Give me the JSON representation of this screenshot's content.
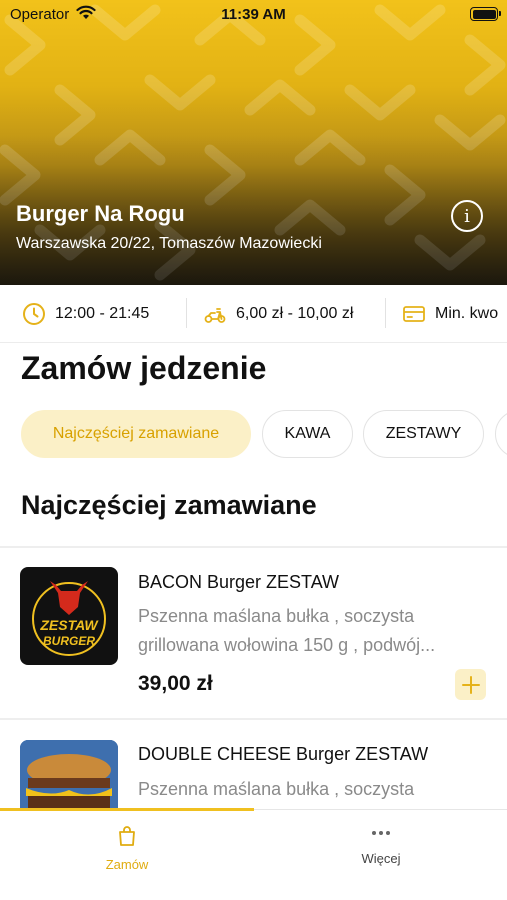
{
  "status_bar": {
    "carrier": "Operator",
    "time": "11:39 AM"
  },
  "restaurant": {
    "name": "Burger Na Rogu",
    "address": "Warszawska 20/22, Tomaszów Mazowiecki"
  },
  "info_strip": {
    "hours": "12:00 - 21:45",
    "delivery_fee": "6,00 zł - 10,00 zł",
    "min_order": "Min. kwo",
    "icons": [
      "clock-icon",
      "scooter-icon",
      "card-icon"
    ]
  },
  "section_heading": "Zamów jedzenie",
  "categories": [
    {
      "label": "Najczęściej zamawiane",
      "active": true
    },
    {
      "label": "KAWA",
      "active": false
    },
    {
      "label": "ZESTAWY",
      "active": false
    }
  ],
  "category_title": "Najczęściej zamawiane",
  "products": [
    {
      "name": "BACON Burger ZESTAW",
      "desc_line1": "Pszenna maślana bułka , soczysta",
      "desc_line2": "grillowana wołowina 150 g , podwój...",
      "price": "39,00 zł",
      "logo_line1": "ZESTAW",
      "logo_line2": "BURGER"
    },
    {
      "name": "DOUBLE CHEESE Burger ZESTAW",
      "desc_line1": "Pszenna maślana bułka , soczysta"
    }
  ],
  "tabs": [
    {
      "label": "Zamów",
      "icon": "bag-icon",
      "active": true
    },
    {
      "label": "Więcej",
      "icon": "more-dots-icon",
      "active": false
    }
  ],
  "colors": {
    "accent": "#F0C020",
    "accent_text": "#D8A100",
    "chip_active_bg": "#FBF0C7",
    "muted_text": "#8A8A8A"
  }
}
